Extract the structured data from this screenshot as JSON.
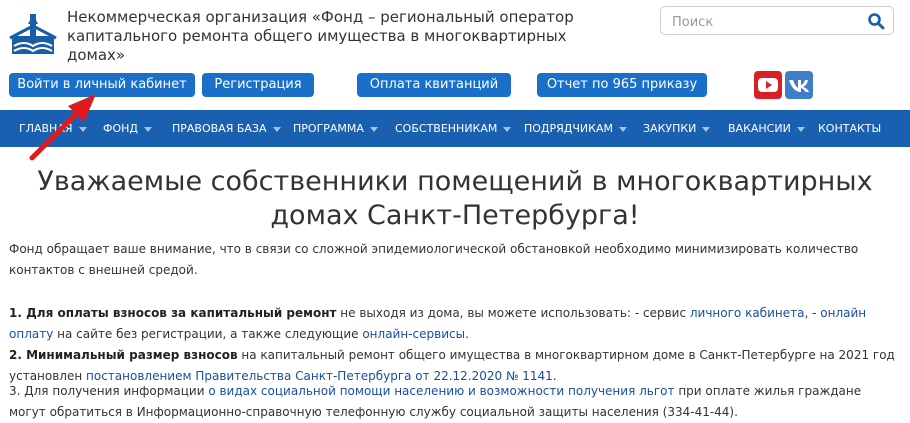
{
  "header": {
    "org_name": "Некоммерческая организация «Фонд – региональный оператор капитального ремонта общего имущества в многоквартирных домах»",
    "search_placeholder": "Поиск"
  },
  "buttons": {
    "login": "Войти в личный кабинет",
    "register": "Регистрация",
    "payment": "Оплата квитанций",
    "report": "Отчет по 965 приказу"
  },
  "social": [
    "youtube-icon",
    "vk-icon"
  ],
  "nav": [
    {
      "label": "ГЛАВНАЯ",
      "has_dropdown": true
    },
    {
      "label": "ФОНД",
      "has_dropdown": true
    },
    {
      "label": "ПРАВОВАЯ БАЗА",
      "has_dropdown": true
    },
    {
      "label": "ПРОГРАММА",
      "has_dropdown": true
    },
    {
      "label": "СОБСТВЕННИКАМ",
      "has_dropdown": true
    },
    {
      "label": "ПОДРЯДЧИКАМ",
      "has_dropdown": true
    },
    {
      "label": "ЗАКУПКИ",
      "has_dropdown": true
    },
    {
      "label": "ВАКАНСИИ",
      "has_dropdown": true
    },
    {
      "label": "КОНТАКТЫ",
      "has_dropdown": false
    }
  ],
  "main": {
    "title": "Уважаемые собственники помещений в многоквартирных домах Санкт-Петербурга!",
    "intro": "Фонд обращает ваше внимание, что в связи со сложной эпидемиологической обстановкой необходимо минимизировать количество контактов с внешней средой.",
    "item1": {
      "bold": "1. Для оплаты взносов за капитальный ремонт",
      "text1": " не выходя из дома, вы можете использовать: - сервис ",
      "link1": "личного кабинета",
      "text2": ", - ",
      "link2": "онлайн оплату",
      "text3": " на сайте без регистрации, а также следующие ",
      "link3": "онлайн-сервисы",
      "text4": "."
    },
    "item2": {
      "bold": "2. Минимальный размер взносов",
      "text1": " на капитальный ремонт общего имущества в многоквартирном доме в Санкт-Петербурге на 2021 год установлен ",
      "link1": "постановлением Правительства Санкт-Петербурга от 22.12.2020 № 1141",
      "text2": "."
    },
    "item3": {
      "text1": "3. Для получения информации ",
      "link1": "о видах социальной помощи населению и возможности получения льгот",
      "text2": " при оплате жилья граждане могут обратиться в Информационно-справочную телефонную службу социальной защиты населения (334-41-44)."
    }
  },
  "colors": {
    "brand_blue": "#1961b0",
    "button_blue": "#1a6fc9",
    "link": "#1a4fa3",
    "youtube_red": "#d92027",
    "vk_blue": "#3f7fc7",
    "annotation_arrow": "#e01b1b"
  }
}
